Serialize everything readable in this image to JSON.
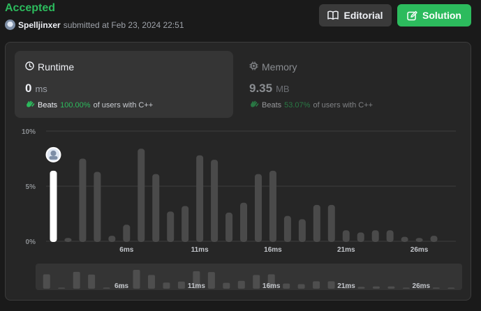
{
  "header": {
    "status": "Accepted",
    "username": "Spelljinxer",
    "submitted_text": "submitted at Feb 23, 2024 22:51",
    "editorial_label": "Editorial",
    "solution_label": "Solution"
  },
  "runtime": {
    "title": "Runtime",
    "value": "0",
    "unit": "ms",
    "beats_label": "Beats",
    "beats_pct": "100.00%",
    "beats_tail": "of users with C++"
  },
  "memory": {
    "title": "Memory",
    "value": "9.35",
    "unit": "MB",
    "beats_label": "Beats",
    "beats_pct": "53.07%",
    "beats_tail": "of users with C++"
  },
  "colors": {
    "accent_green": "#2cbb5d",
    "bar_default": "#4a4a4a",
    "bar_selected": "#ffffff"
  },
  "chart_data": {
    "type": "bar",
    "x": [
      1,
      2,
      3,
      4,
      5,
      6,
      7,
      8,
      9,
      10,
      11,
      12,
      13,
      14,
      15,
      16,
      17,
      18,
      19,
      20,
      21,
      22,
      23,
      24,
      25,
      26,
      27,
      28
    ],
    "values": [
      6.4,
      0.3,
      7.5,
      6.3,
      0.5,
      1.5,
      8.4,
      6.1,
      2.7,
      3.2,
      7.8,
      7.4,
      2.6,
      3.5,
      6.1,
      6.4,
      2.3,
      2.0,
      3.3,
      3.3,
      1.0,
      0.8,
      1.0,
      1.0,
      0.4,
      0.3,
      0.5,
      0.0
    ],
    "selected_index": 0,
    "ylim": [
      0,
      10
    ],
    "y_ticks": [
      "0%",
      "5%",
      "10%"
    ],
    "x_ticks": [
      "6ms",
      "11ms",
      "16ms",
      "21ms",
      "26ms"
    ],
    "grid": true
  }
}
